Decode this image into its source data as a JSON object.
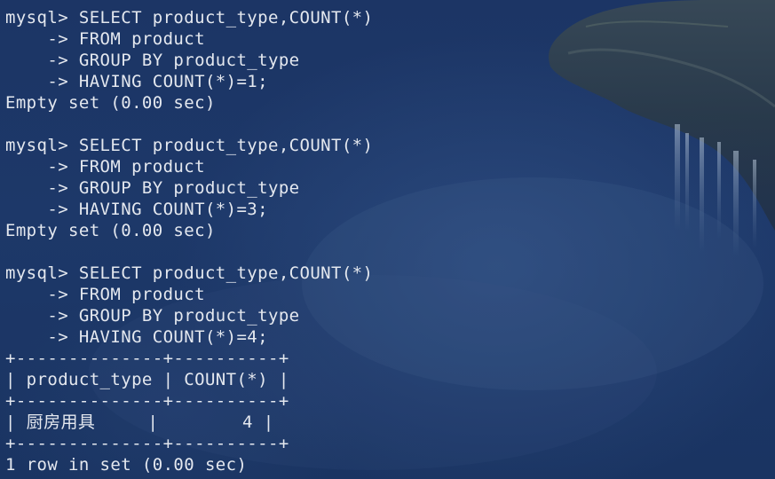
{
  "background": {
    "base_color": "#1b3566",
    "cliff_color": "#2a3a48",
    "waterfall_color": "#9fb4cc"
  },
  "terminal": {
    "text_color": "#e4e8ef",
    "lines": [
      "mysql> SELECT product_type,COUNT(*)",
      "    -> FROM product",
      "    -> GROUP BY product_type",
      "    -> HAVING COUNT(*)=1;",
      "Empty set (0.00 sec)",
      "",
      "mysql> SELECT product_type,COUNT(*)",
      "    -> FROM product",
      "    -> GROUP BY product_type",
      "    -> HAVING COUNT(*)=3;",
      "Empty set (0.00 sec)",
      "",
      "mysql> SELECT product_type,COUNT(*)",
      "    -> FROM product",
      "    -> GROUP BY product_type",
      "    -> HAVING COUNT(*)=4;",
      "+--------------+----------+",
      "| product_type | COUNT(*) |",
      "+--------------+----------+",
      "| 厨房用具     |        4 |",
      "+--------------+----------+",
      "1 row in set (0.00 sec)"
    ]
  }
}
